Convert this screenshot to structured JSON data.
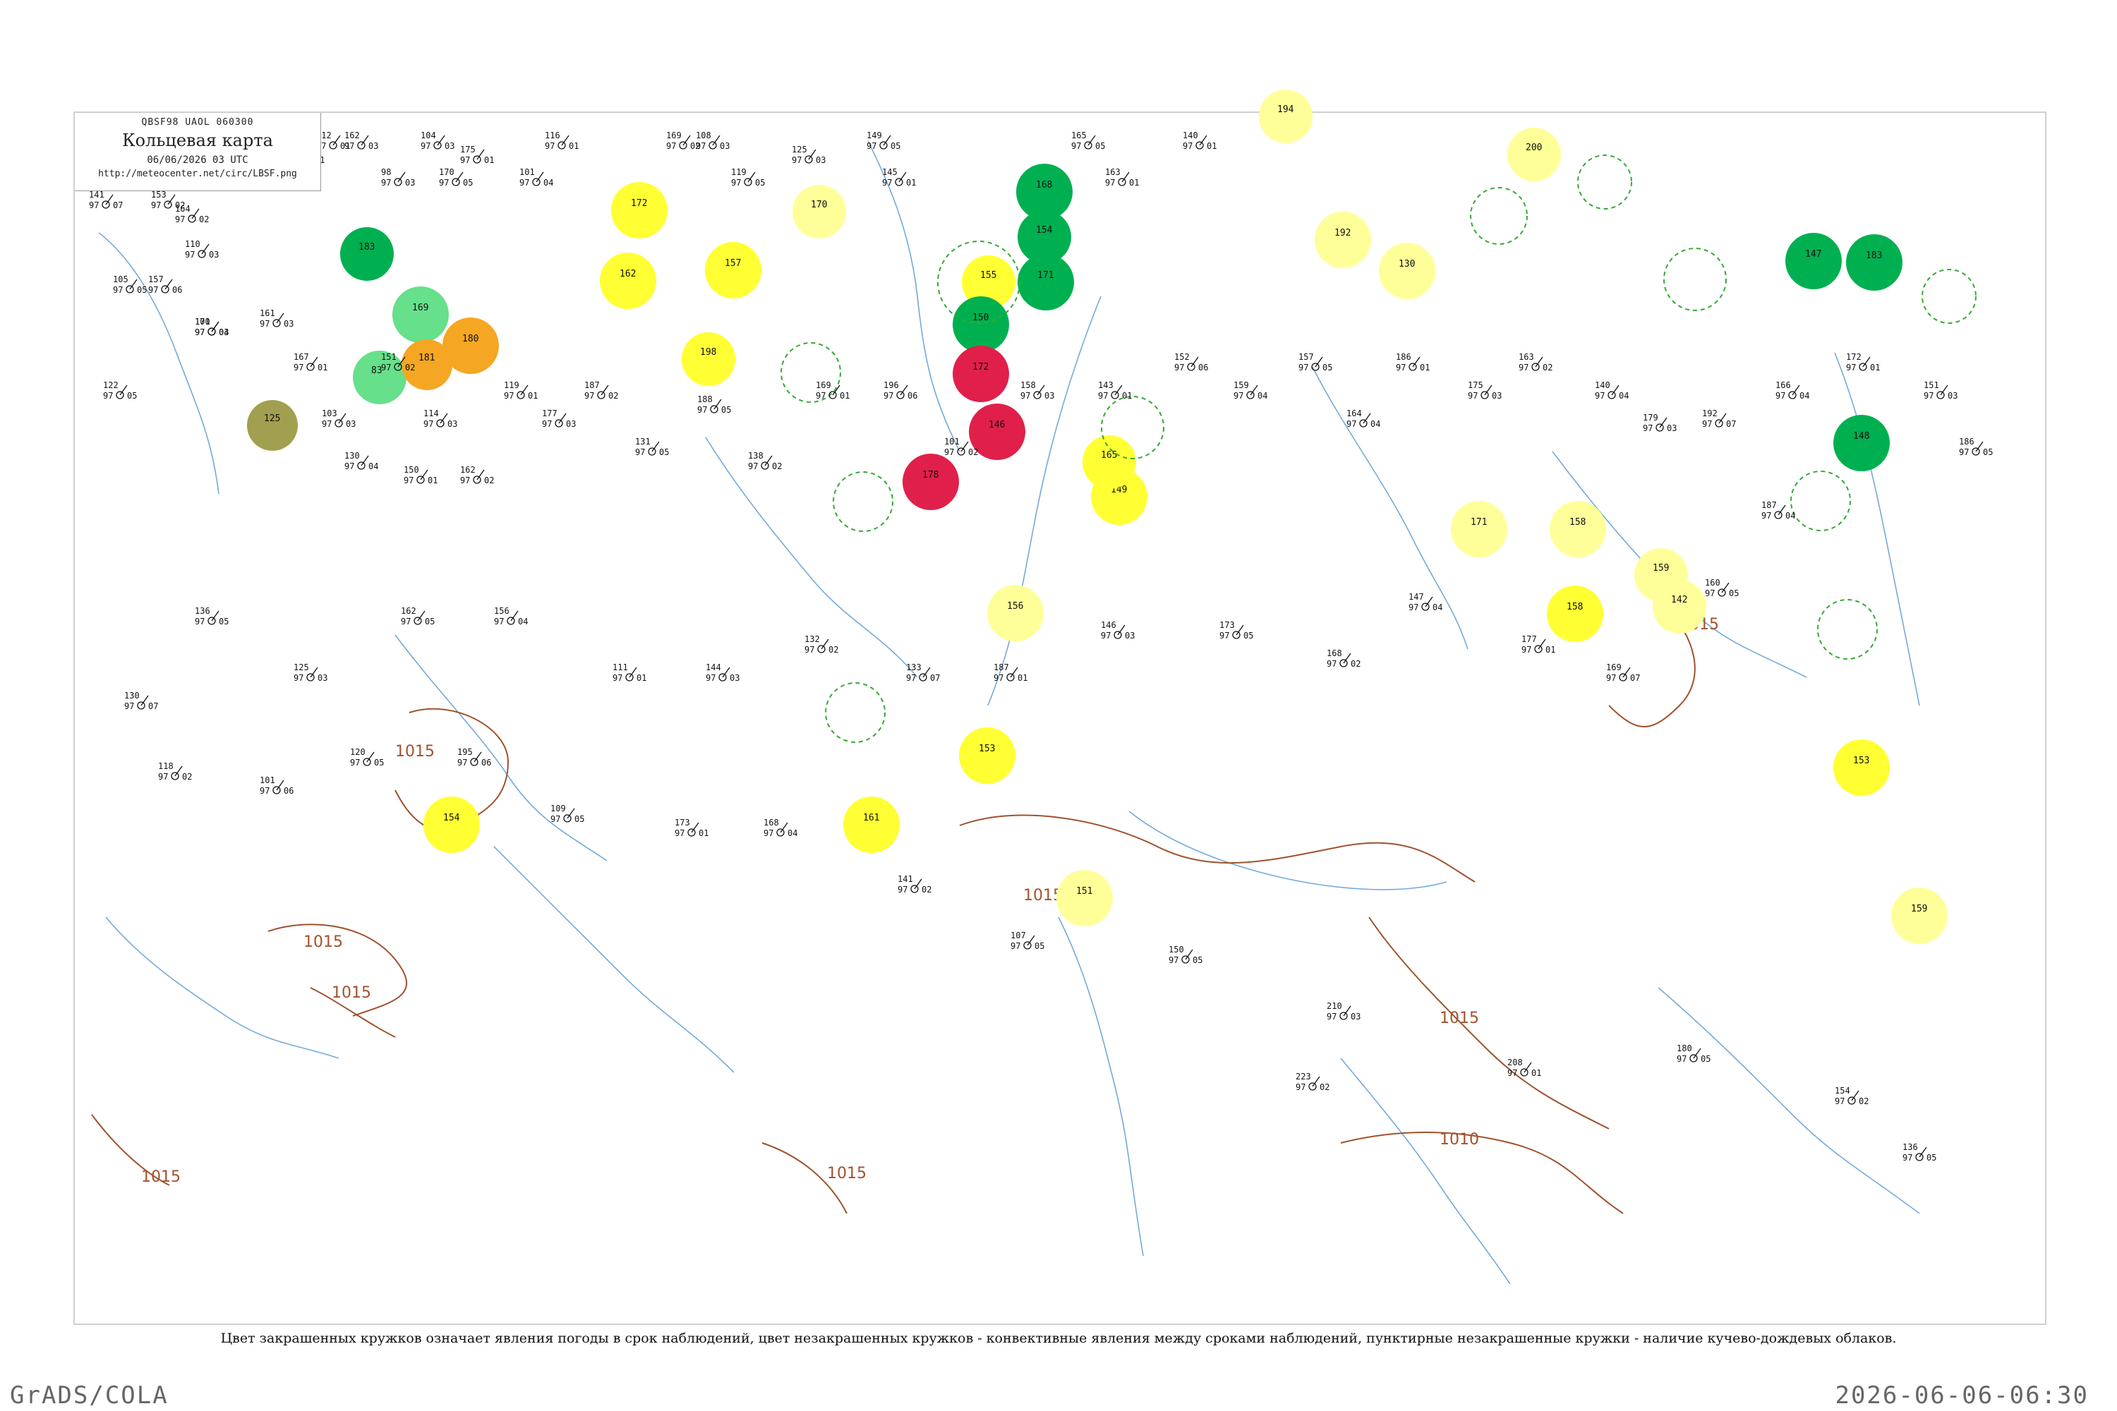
{
  "header": {
    "code": "QBSF98  UAOL  060300",
    "title": "Кольцевая карта",
    "time": "06/06/2026 03 UTC",
    "url": "http://meteocenter.net/circ/LBSF.png"
  },
  "caption": "Цвет закрашенных кружков означает явления погоды в срок наблюдений, цвет незакрашенных кружков - конвективные явления между сроками наблюдений, пунктирные незакрашенные кружки - наличие кучево-дождевых облаков.",
  "footer": {
    "left": "GrADS/COLA",
    "right": "2026-06-06-06:30"
  },
  "colors": {
    "isobar": "#a0522d",
    "river": "#5b9bd5",
    "coast": "#5b9bd5",
    "yellow": "#ffff33",
    "pale_yellow": "#ffff99",
    "green": "#00b050",
    "light_green": "#66e08a",
    "orange": "#f5a623",
    "red": "#e0204a",
    "olive": "#a0a050",
    "dashed": "#33aa33"
  },
  "isobars": [
    {
      "label": "1015"
    },
    {
      "label": "1015"
    },
    {
      "label": "1015"
    },
    {
      "label": "1015"
    },
    {
      "label": "1015"
    },
    {
      "label": "1015"
    },
    {
      "label": "1015"
    },
    {
      "label": "1010"
    },
    {
      "label": "1015"
    }
  ],
  "weather_circles": [
    {
      "kind": "filled",
      "color": "green",
      "label": "183"
    },
    {
      "kind": "filled",
      "color": "light_green",
      "label": "169"
    },
    {
      "kind": "filled",
      "color": "light_green",
      "label": "83"
    },
    {
      "kind": "filled",
      "color": "orange",
      "label": "180"
    },
    {
      "kind": "filled",
      "color": "orange",
      "label": "181"
    },
    {
      "kind": "filled",
      "color": "olive",
      "label": "125"
    },
    {
      "kind": "filled",
      "color": "yellow",
      "label": "172"
    },
    {
      "kind": "filled",
      "color": "yellow",
      "label": "162"
    },
    {
      "kind": "filled",
      "color": "yellow",
      "label": "157"
    },
    {
      "kind": "filled",
      "color": "yellow",
      "label": "198"
    },
    {
      "kind": "filled",
      "color": "pale_yellow",
      "label": "170"
    },
    {
      "kind": "filled",
      "color": "green",
      "label": "168"
    },
    {
      "kind": "filled",
      "color": "green",
      "label": "154"
    },
    {
      "kind": "filled",
      "color": "yellow",
      "label": "155"
    },
    {
      "kind": "filled",
      "color": "green",
      "label": "171"
    },
    {
      "kind": "filled",
      "color": "green",
      "label": "150"
    },
    {
      "kind": "filled",
      "color": "red",
      "label": "172"
    },
    {
      "kind": "filled",
      "color": "red",
      "label": "146"
    },
    {
      "kind": "filled",
      "color": "red",
      "label": "178"
    },
    {
      "kind": "filled",
      "color": "yellow",
      "label": "149"
    },
    {
      "kind": "filled",
      "color": "yellow",
      "label": "165"
    },
    {
      "kind": "filled",
      "color": "pale_yellow",
      "label": "156"
    },
    {
      "kind": "filled",
      "color": "yellow",
      "label": "153"
    },
    {
      "kind": "filled",
      "color": "yellow",
      "label": "154"
    },
    {
      "kind": "filled",
      "color": "yellow",
      "label": "161"
    },
    {
      "kind": "filled",
      "color": "pale_yellow",
      "label": "151"
    },
    {
      "kind": "filled",
      "color": "pale_yellow",
      "label": "194"
    },
    {
      "kind": "filled",
      "color": "pale_yellow",
      "label": "192"
    },
    {
      "kind": "filled",
      "color": "pale_yellow",
      "label": "130"
    },
    {
      "kind": "filled",
      "color": "pale_yellow",
      "label": "200"
    },
    {
      "kind": "filled",
      "color": "pale_yellow",
      "label": "171"
    },
    {
      "kind": "filled",
      "color": "pale_yellow",
      "label": "158"
    },
    {
      "kind": "filled",
      "color": "yellow",
      "label": "158"
    },
    {
      "kind": "filled",
      "color": "pale_yellow",
      "label": "159"
    },
    {
      "kind": "filled",
      "color": "green",
      "label": "147"
    },
    {
      "kind": "filled",
      "color": "green",
      "label": "148"
    },
    {
      "kind": "filled",
      "color": "green",
      "label": "183"
    },
    {
      "kind": "filled",
      "color": "yellow",
      "label": "153"
    },
    {
      "kind": "filled",
      "color": "pale_yellow",
      "label": "159"
    },
    {
      "kind": "filled",
      "color": "pale_yellow",
      "label": "142"
    },
    {
      "kind": "dashed",
      "label": ""
    },
    {
      "kind": "dashed",
      "label": ""
    },
    {
      "kind": "dashed",
      "label": ""
    },
    {
      "kind": "dashed",
      "label": ""
    },
    {
      "kind": "dashed",
      "label": ""
    },
    {
      "kind": "dashed",
      "label": ""
    },
    {
      "kind": "dashed",
      "label": ""
    },
    {
      "kind": "dashed",
      "label": ""
    },
    {
      "kind": "dashed",
      "label": ""
    },
    {
      "kind": "dashed",
      "label": ""
    },
    {
      "kind": "dashed",
      "label": ""
    }
  ],
  "stations": [
    {
      "p": "141",
      "t": "97",
      "d": "07"
    },
    {
      "p": "153",
      "t": "97",
      "d": "02"
    },
    {
      "p": "164",
      "t": "97",
      "d": "02"
    },
    {
      "p": "110",
      "t": "97",
      "d": "03"
    },
    {
      "p": "112",
      "t": "97",
      "d": "01"
    },
    {
      "p": "162",
      "t": "97",
      "d": "03"
    },
    {
      "p": "166",
      "t": "97",
      "d": "01"
    },
    {
      "p": "98",
      "t": "97",
      "d": "03"
    },
    {
      "p": "170",
      "t": "97",
      "d": "05"
    },
    {
      "p": "104",
      "t": "97",
      "d": "03"
    },
    {
      "p": "175",
      "t": "97",
      "d": "01"
    },
    {
      "p": "116",
      "t": "97",
      "d": "01"
    },
    {
      "p": "101",
      "t": "97",
      "d": "04"
    },
    {
      "p": "169",
      "t": "97",
      "d": "02"
    },
    {
      "p": "119",
      "t": "97",
      "d": "05"
    },
    {
      "p": "108",
      "t": "97",
      "d": "03"
    },
    {
      "p": "125",
      "t": "97",
      "d": "03"
    },
    {
      "p": "149",
      "t": "97",
      "d": "05"
    },
    {
      "p": "145",
      "t": "97",
      "d": "01"
    },
    {
      "p": "165",
      "t": "97",
      "d": "05"
    },
    {
      "p": "163",
      "t": "97",
      "d": "01"
    },
    {
      "p": "140",
      "t": "97",
      "d": "01"
    },
    {
      "p": "105",
      "t": "97",
      "d": "05"
    },
    {
      "p": "171",
      "t": "97",
      "d": "03"
    },
    {
      "p": "157",
      "t": "97",
      "d": "06"
    },
    {
      "p": "100",
      "t": "97",
      "d": "04"
    },
    {
      "p": "122",
      "t": "97",
      "d": "05"
    },
    {
      "p": "161",
      "t": "97",
      "d": "03"
    },
    {
      "p": "167",
      "t": "97",
      "d": "01"
    },
    {
      "p": "151",
      "t": "97",
      "d": "02"
    },
    {
      "p": "114",
      "t": "97",
      "d": "03"
    },
    {
      "p": "119",
      "t": "97",
      "d": "01"
    },
    {
      "p": "103",
      "t": "97",
      "d": "03"
    },
    {
      "p": "130",
      "t": "97",
      "d": "04"
    },
    {
      "p": "150",
      "t": "97",
      "d": "01"
    },
    {
      "p": "162",
      "t": "97",
      "d": "02"
    },
    {
      "p": "177",
      "t": "97",
      "d": "03"
    },
    {
      "p": "187",
      "t": "97",
      "d": "02"
    },
    {
      "p": "131",
      "t": "97",
      "d": "05"
    },
    {
      "p": "188",
      "t": "97",
      "d": "05"
    },
    {
      "p": "138",
      "t": "97",
      "d": "02"
    },
    {
      "p": "169",
      "t": "97",
      "d": "01"
    },
    {
      "p": "196",
      "t": "97",
      "d": "06"
    },
    {
      "p": "101",
      "t": "97",
      "d": "02"
    },
    {
      "p": "158",
      "t": "97",
      "d": "03"
    },
    {
      "p": "143",
      "t": "97",
      "d": "01"
    },
    {
      "p": "152",
      "t": "97",
      "d": "06"
    },
    {
      "p": "159",
      "t": "97",
      "d": "04"
    },
    {
      "p": "157",
      "t": "97",
      "d": "05"
    },
    {
      "p": "164",
      "t": "97",
      "d": "04"
    },
    {
      "p": "186",
      "t": "97",
      "d": "01"
    },
    {
      "p": "175",
      "t": "97",
      "d": "03"
    },
    {
      "p": "163",
      "t": "97",
      "d": "02"
    },
    {
      "p": "140",
      "t": "97",
      "d": "04"
    },
    {
      "p": "179",
      "t": "97",
      "d": "03"
    },
    {
      "p": "192",
      "t": "97",
      "d": "07"
    },
    {
      "p": "166",
      "t": "97",
      "d": "04"
    },
    {
      "p": "172",
      "t": "97",
      "d": "01"
    },
    {
      "p": "151",
      "t": "97",
      "d": "03"
    },
    {
      "p": "186",
      "t": "97",
      "d": "05"
    },
    {
      "p": "187",
      "t": "97",
      "d": "04"
    },
    {
      "p": "160",
      "t": "97",
      "d": "05"
    },
    {
      "p": "169",
      "t": "97",
      "d": "07"
    },
    {
      "p": "177",
      "t": "97",
      "d": "01"
    },
    {
      "p": "147",
      "t": "97",
      "d": "04"
    },
    {
      "p": "168",
      "t": "97",
      "d": "02"
    },
    {
      "p": "173",
      "t": "97",
      "d": "05"
    },
    {
      "p": "146",
      "t": "97",
      "d": "03"
    },
    {
      "p": "187",
      "t": "97",
      "d": "01"
    },
    {
      "p": "133",
      "t": "97",
      "d": "07"
    },
    {
      "p": "132",
      "t": "97",
      "d": "02"
    },
    {
      "p": "144",
      "t": "97",
      "d": "03"
    },
    {
      "p": "111",
      "t": "97",
      "d": "01"
    },
    {
      "p": "156",
      "t": "97",
      "d": "04"
    },
    {
      "p": "162",
      "t": "97",
      "d": "05"
    },
    {
      "p": "125",
      "t": "97",
      "d": "03"
    },
    {
      "p": "136",
      "t": "97",
      "d": "05"
    },
    {
      "p": "130",
      "t": "97",
      "d": "07"
    },
    {
      "p": "118",
      "t": "97",
      "d": "02"
    },
    {
      "p": "101",
      "t": "97",
      "d": "06"
    },
    {
      "p": "120",
      "t": "97",
      "d": "05"
    },
    {
      "p": "195",
      "t": "97",
      "d": "06"
    },
    {
      "p": "109",
      "t": "97",
      "d": "05"
    },
    {
      "p": "173",
      "t": "97",
      "d": "01"
    },
    {
      "p": "168",
      "t": "97",
      "d": "04"
    },
    {
      "p": "141",
      "t": "97",
      "d": "02"
    },
    {
      "p": "107",
      "t": "97",
      "d": "05"
    },
    {
      "p": "150",
      "t": "97",
      "d": "05"
    },
    {
      "p": "210",
      "t": "97",
      "d": "03"
    },
    {
      "p": "223",
      "t": "97",
      "d": "02"
    },
    {
      "p": "208",
      "t": "97",
      "d": "01"
    },
    {
      "p": "180",
      "t": "97",
      "d": "05"
    },
    {
      "p": "154",
      "t": "97",
      "d": "02"
    },
    {
      "p": "136",
      "t": "97",
      "d": "05"
    }
  ]
}
